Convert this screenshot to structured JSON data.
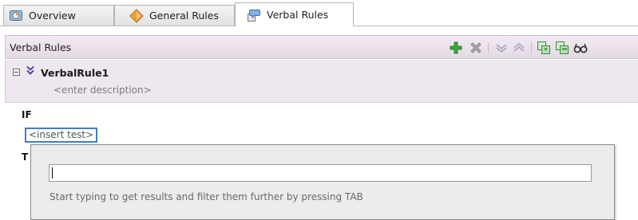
{
  "tabs": [
    {
      "label": "Overview",
      "icon": "overview-icon",
      "active": false
    },
    {
      "label": "General Rules",
      "icon": "general-rules-icon",
      "active": false
    },
    {
      "label": "Verbal Rules",
      "icon": "verbal-rules-icon",
      "active": true
    }
  ],
  "header": {
    "title": "Verbal Rules",
    "tools": [
      "add-icon",
      "delete-icon",
      "expand-all-icon",
      "collapse-all-icon",
      "add-rule-icon",
      "remove-rule-icon",
      "show-advanced-icon"
    ]
  },
  "rule": {
    "name": "VerbalRule1",
    "description_placeholder": "<enter description>"
  },
  "body": {
    "if_label": "IF",
    "insert_test": "<insert test>",
    "then_label": "T"
  },
  "popup": {
    "input_value": "",
    "hint": "Start typing to get results and filter them further by pressing TAB"
  },
  "colors": {
    "header_bg": "#e8e0e8",
    "rule_bg": "#efe7ef",
    "focus_border": "#3f7fc8",
    "add_green": "#3aa83a"
  }
}
